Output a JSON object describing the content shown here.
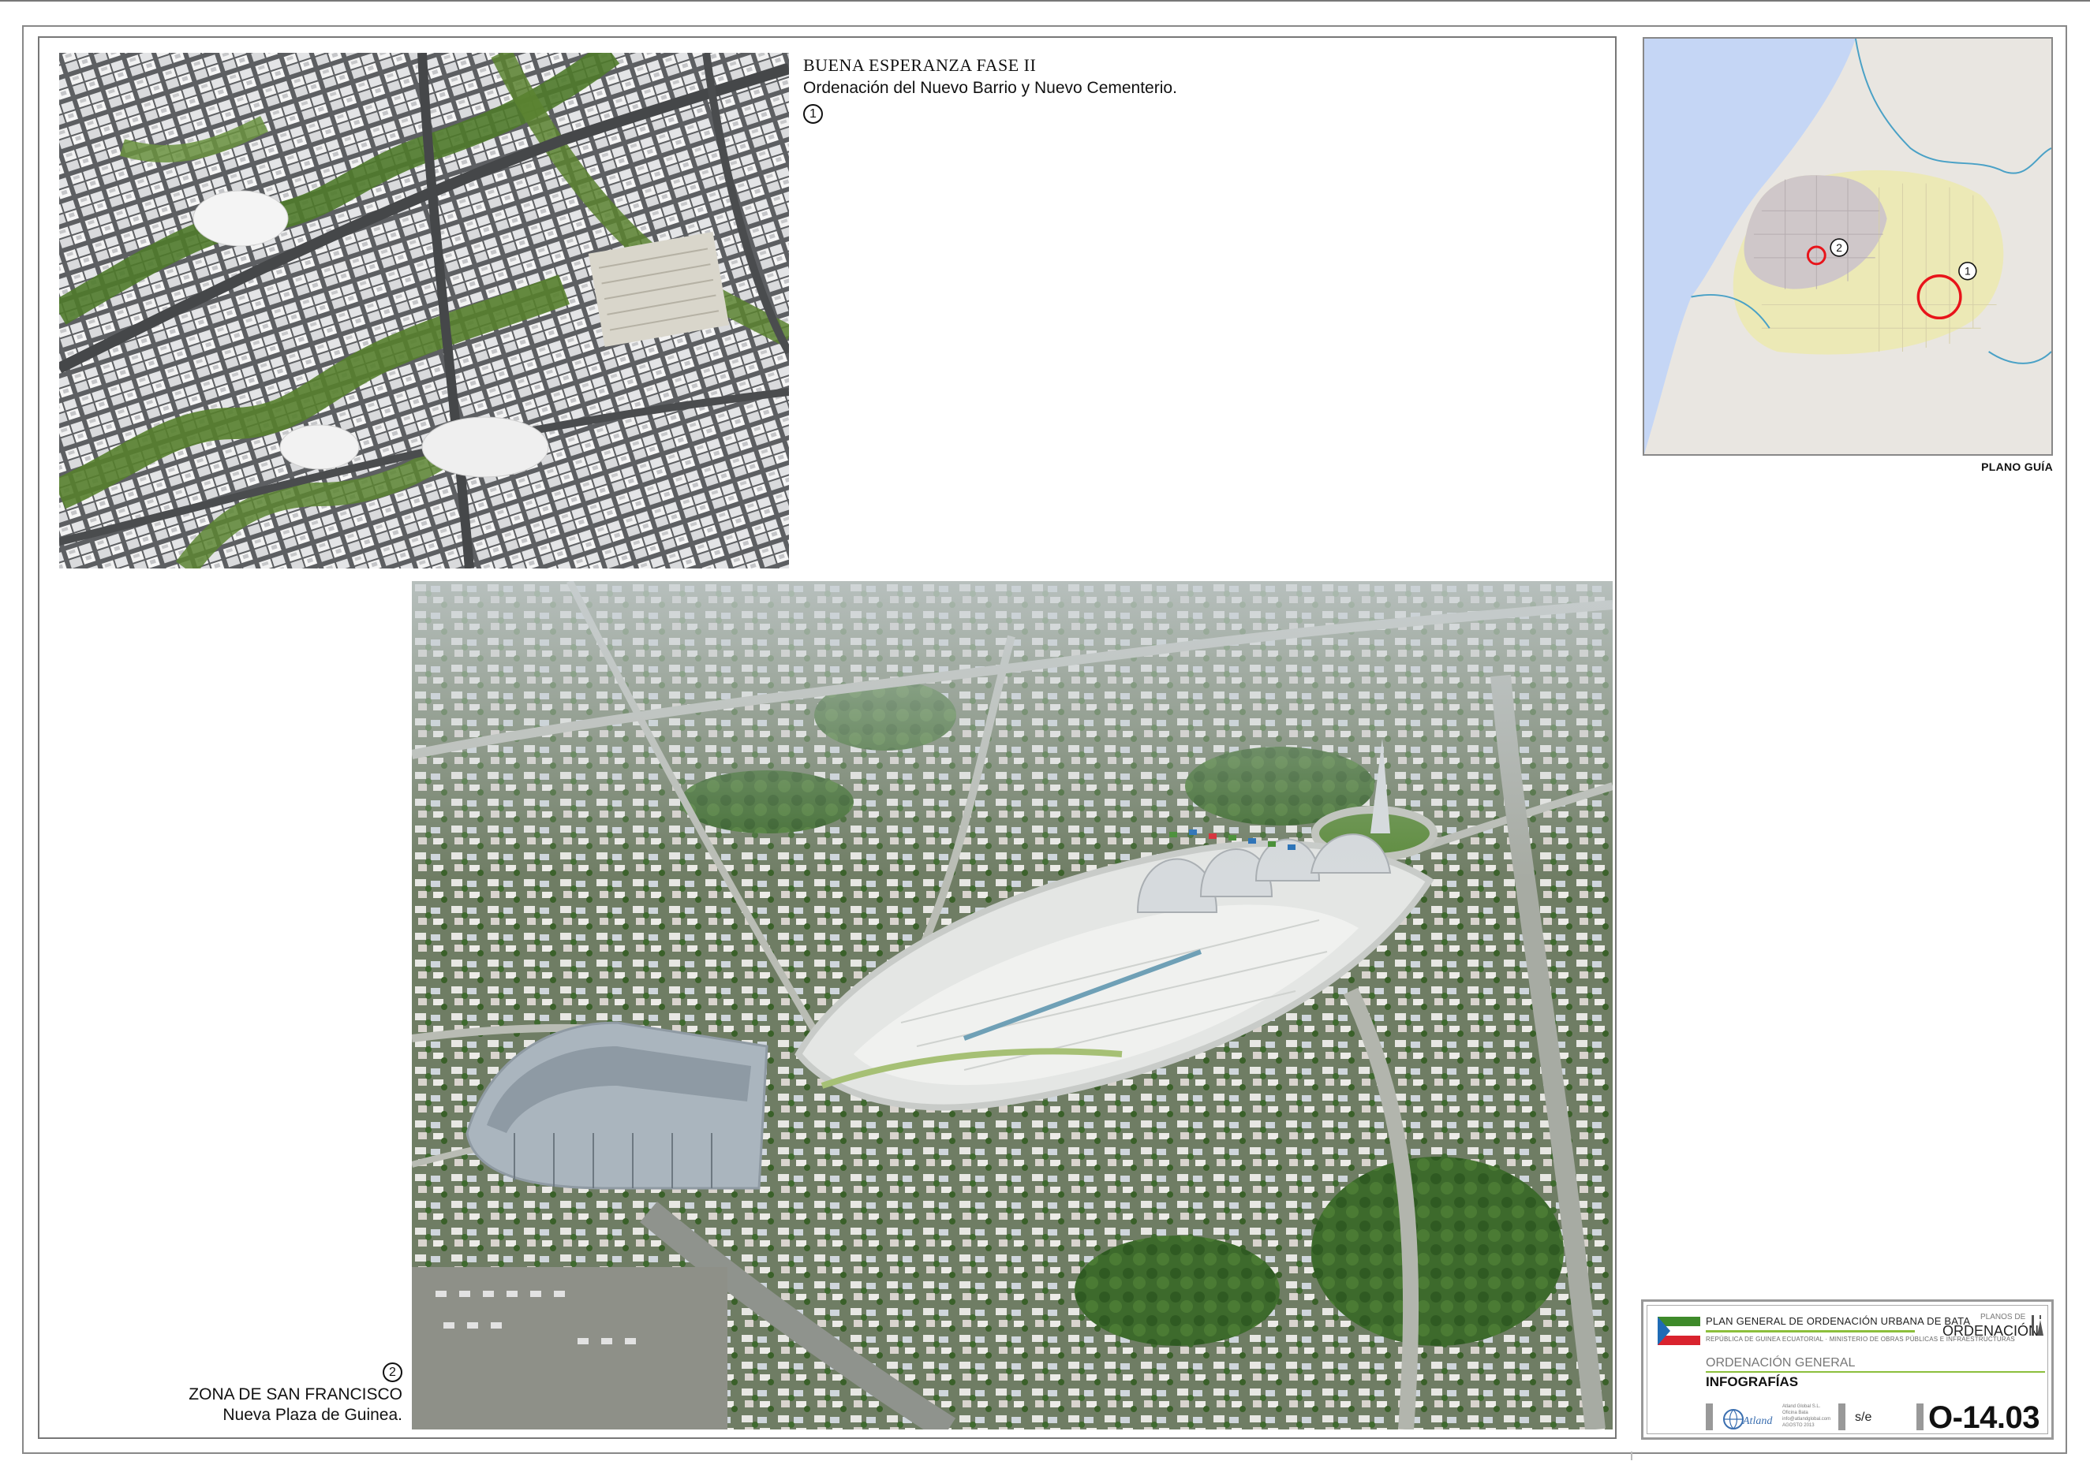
{
  "top_panel": {
    "title": "BUENA ESPERANZA FASE II",
    "subtitle": "Ordenación del Nuevo Barrio y Nuevo Cementerio.",
    "marker": "1"
  },
  "bottom_panel": {
    "marker": "2",
    "caption_line1": "ZONA DE SAN FRANCISCO",
    "caption_line2": "Nueva Plaza de Guinea."
  },
  "guide_map": {
    "label": "PLANO GUÍA",
    "marker_1": "1",
    "marker_2": "2",
    "highlight_color": "#e8141a",
    "sea_color": "#c5d6f5",
    "land_color": "#e9e6e1",
    "urban_color": "#ece9b6"
  },
  "cartouche": {
    "plan_title": "PLAN GENERAL DE ORDENACIÓN URBANA DE BATA",
    "republic_line": "REPÚBLICA DE GUINEA ECUATORIAL · MINISTERIO DE OBRAS PÚBLICAS E INFRAESTRUCTURAS",
    "planos_de": "PLANOS DE",
    "ordenacion": "ORDENACIÓN",
    "section": "ORDENACIÓN GENERAL",
    "sheet_title": "INFOGRAFÍAS",
    "company_lines": [
      "Atland Global S.L.",
      "Oficina Bata",
      "info@atlandglobal.com",
      "AGOSTO 2013"
    ],
    "scale": "s/e",
    "code": "O-14.03",
    "accent_color": "#8cbf3c",
    "flag_colors": {
      "green": "#3e8a2a",
      "white": "#ffffff",
      "red": "#d9232e",
      "blue": "#1f6bb5"
    }
  }
}
